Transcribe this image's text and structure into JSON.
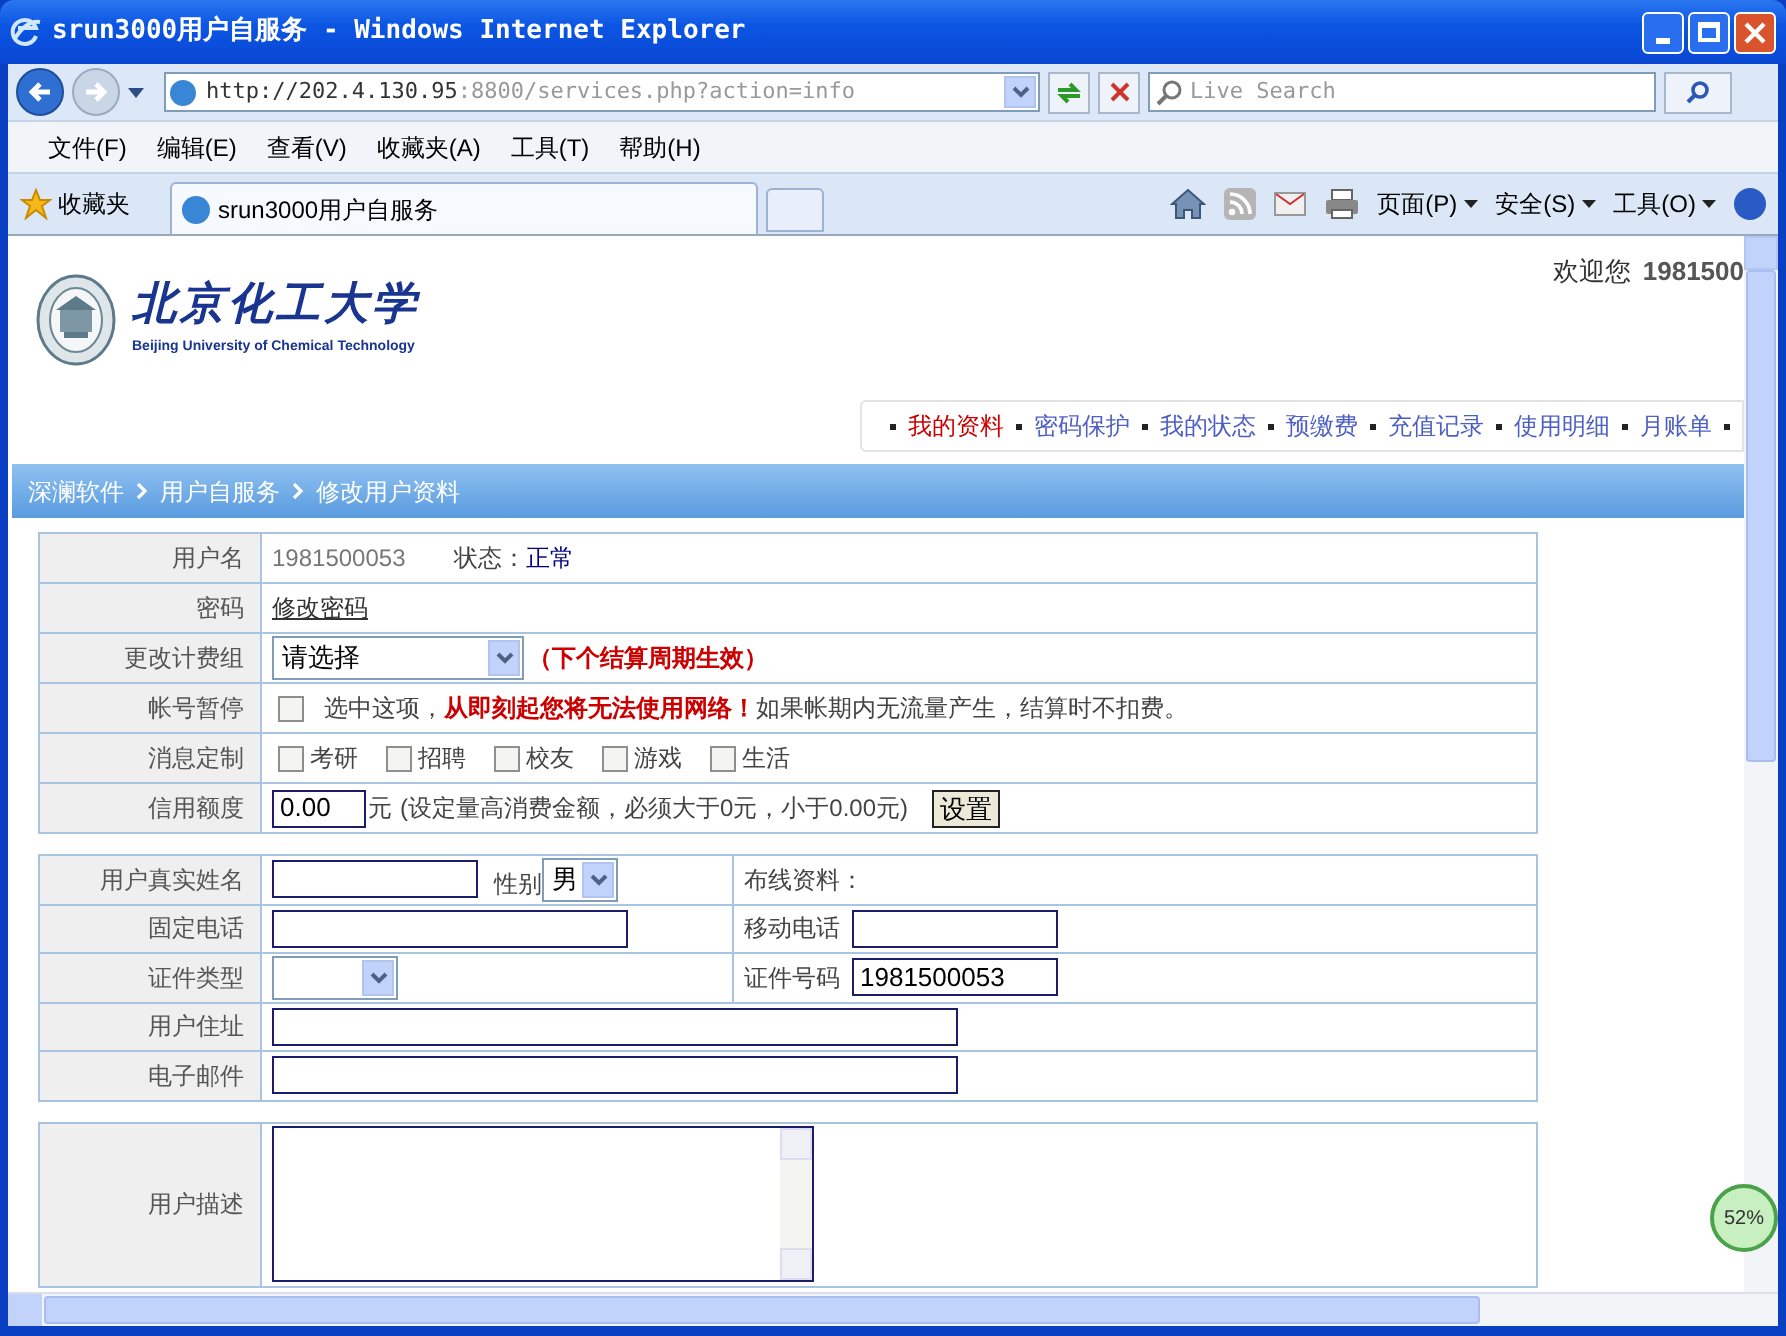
{
  "window": {
    "title": "srun3000用户自服务 - Windows Internet Explorer"
  },
  "browser": {
    "address_host": "http://202.4.130.95",
    "address_rest": ":8800/services.php?action=info",
    "search_placeholder": "Live Search",
    "menu": [
      "文件(F)",
      "编辑(E)",
      "查看(V)",
      "收藏夹(A)",
      "工具(T)",
      "帮助(H)"
    ],
    "favorites": "收藏夹",
    "tab": "srun3000用户自服务",
    "commands": [
      "页面(P)",
      "安全(S)",
      "工具(O)"
    ]
  },
  "header": {
    "welcome": "欢迎您",
    "user": "1981500",
    "school_name": "北京化工大学",
    "school_english": "Beijing University of Chemical Technology"
  },
  "nav": [
    {
      "label": "我的资料",
      "selected": true
    },
    {
      "label": "密码保护",
      "selected": false
    },
    {
      "label": "我的状态",
      "selected": false
    },
    {
      "label": "预缴费",
      "selected": false
    },
    {
      "label": "充值记录",
      "selected": false
    },
    {
      "label": "使用明细",
      "selected": false
    },
    {
      "label": "月账单",
      "selected": false
    }
  ],
  "breadcrumb": [
    "深澜软件",
    "用户自服务",
    "修改用户资料"
  ],
  "account": [
    {
      "kind": "status",
      "label": "用户名",
      "value": "1981500053",
      "status_label": "状态：",
      "status": "正常"
    },
    {
      "kind": "link",
      "label": "密码",
      "link": "修改密码"
    },
    {
      "kind": "select",
      "label": "更改计费组",
      "value": "请选择",
      "note": "（下个结算周期生效）"
    },
    {
      "kind": "suspend",
      "label": "帐号暂停",
      "checked": false,
      "text": "选中这项，",
      "warning": "从即刻起您将无法使用网络！",
      "note": "如果帐期内无流量产生，结算时不扣费。"
    },
    {
      "kind": "options",
      "label": "消息定制",
      "options": [
        {
          "label": "考研",
          "checked": false
        },
        {
          "label": "招聘",
          "checked": false
        },
        {
          "label": "校友",
          "checked": false
        },
        {
          "label": "游戏",
          "checked": false
        },
        {
          "label": "生活",
          "checked": false
        }
      ]
    },
    {
      "kind": "credit",
      "label": "信用额度",
      "value": "0.00",
      "unit": "元",
      "note": "(设定量高消费金额，必须大于0元，小于0.00元)",
      "button": "设置"
    }
  ],
  "profile": [
    {
      "label": "用户真实姓名",
      "fields": [
        {
          "kind": "input"
        },
        {
          "kind": "text",
          "text": "性别"
        },
        {
          "kind": "select",
          "value": "男"
        }
      ],
      "right": {
        "label": "布线资料："
      }
    },
    {
      "label": "固定电话",
      "fields": [
        {
          "kind": "line"
        }
      ],
      "right": {
        "label": "移动电话",
        "field": {
          "kind": "input"
        }
      }
    },
    {
      "label": "证件类型",
      "fields": [
        {
          "kind": "select"
        }
      ],
      "right": {
        "label": "证件号码",
        "field": {
          "kind": "input",
          "value": "1981500053"
        }
      }
    },
    {
      "label": "用户住址",
      "fields": [
        {
          "kind": "wide"
        }
      ]
    },
    {
      "label": "电子邮件",
      "fields": [
        {
          "kind": "wide"
        }
      ]
    }
  ],
  "description": {
    "label": "用户描述"
  },
  "zoom_badge": "52%"
}
